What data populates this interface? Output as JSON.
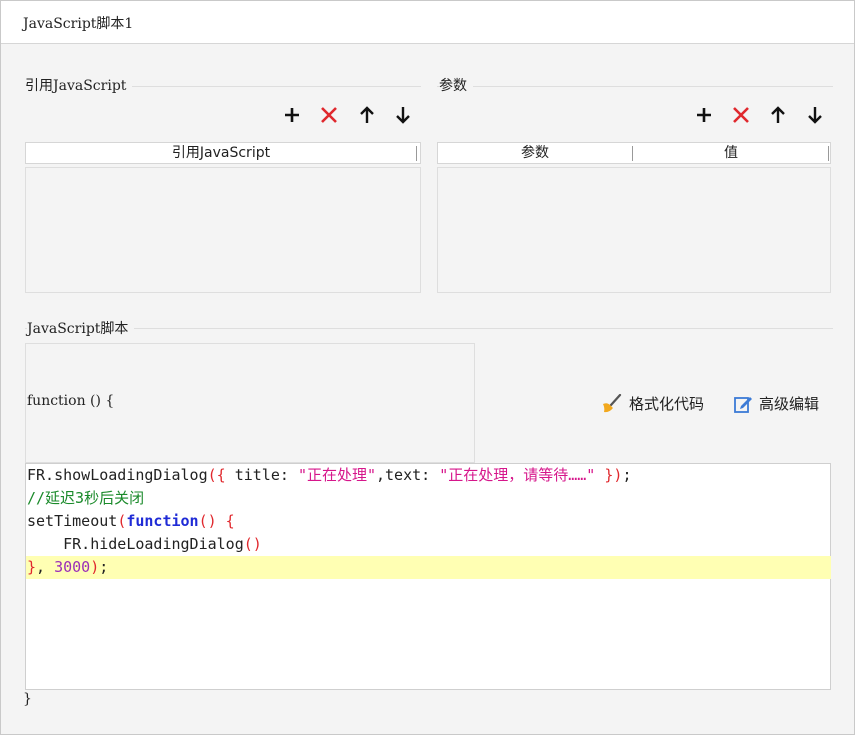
{
  "window": {
    "title": "JavaScript脚本1"
  },
  "ref_js": {
    "section_label": "引用JavaScript",
    "column_header": "引用JavaScript",
    "toolbar": [
      "add-icon",
      "delete-icon",
      "move-up-icon",
      "move-down-icon"
    ]
  },
  "params": {
    "section_label": "参数",
    "columns": [
      "参数",
      "值"
    ],
    "toolbar": [
      "add-icon",
      "delete-icon",
      "move-up-icon",
      "move-down-icon"
    ]
  },
  "script": {
    "section_label": "JavaScript脚本",
    "function_header": "function () {",
    "closing_brace": "}",
    "format_code_label": "格式化代码",
    "advanced_edit_label": "高级编辑",
    "code_lines": [
      [
        {
          "t": "FR.showLoadingDialog",
          "c": "tk-default"
        },
        {
          "t": "({",
          "c": "tk-paren"
        },
        {
          "t": " title: ",
          "c": "tk-default"
        },
        {
          "t": "\"正在处理\"",
          "c": "tk-str"
        },
        {
          "t": ",text: ",
          "c": "tk-default"
        },
        {
          "t": "\"正在处理，请等待……\"",
          "c": "tk-str"
        },
        {
          "t": " })",
          "c": "tk-paren"
        },
        {
          "t": ";",
          "c": "tk-default"
        }
      ],
      [
        {
          "t": "//延迟3秒后关闭",
          "c": "tk-comment"
        }
      ],
      [
        {
          "t": "setTimeout",
          "c": "tk-default"
        },
        {
          "t": "(",
          "c": "tk-paren"
        },
        {
          "t": "function",
          "c": "tk-kw"
        },
        {
          "t": "() {",
          "c": "tk-paren"
        }
      ],
      [
        {
          "t": "    FR.hideLoadingDialog",
          "c": "tk-default"
        },
        {
          "t": "()",
          "c": "tk-paren"
        }
      ],
      [
        {
          "t": "}",
          "c": "tk-paren"
        },
        {
          "t": ", ",
          "c": "tk-default"
        },
        {
          "t": "3000",
          "c": "tk-num"
        },
        {
          "t": ")",
          "c": "tk-paren"
        },
        {
          "t": ";",
          "c": "tk-default"
        }
      ]
    ],
    "highlighted_line": 4
  },
  "colors": {
    "accent_red": "#e0282d",
    "string": "#d6168b",
    "comment": "#1a8a2a",
    "keyword": "#1f2bd6",
    "number": "#9b2fb8",
    "highlight": "#ffffb3"
  }
}
